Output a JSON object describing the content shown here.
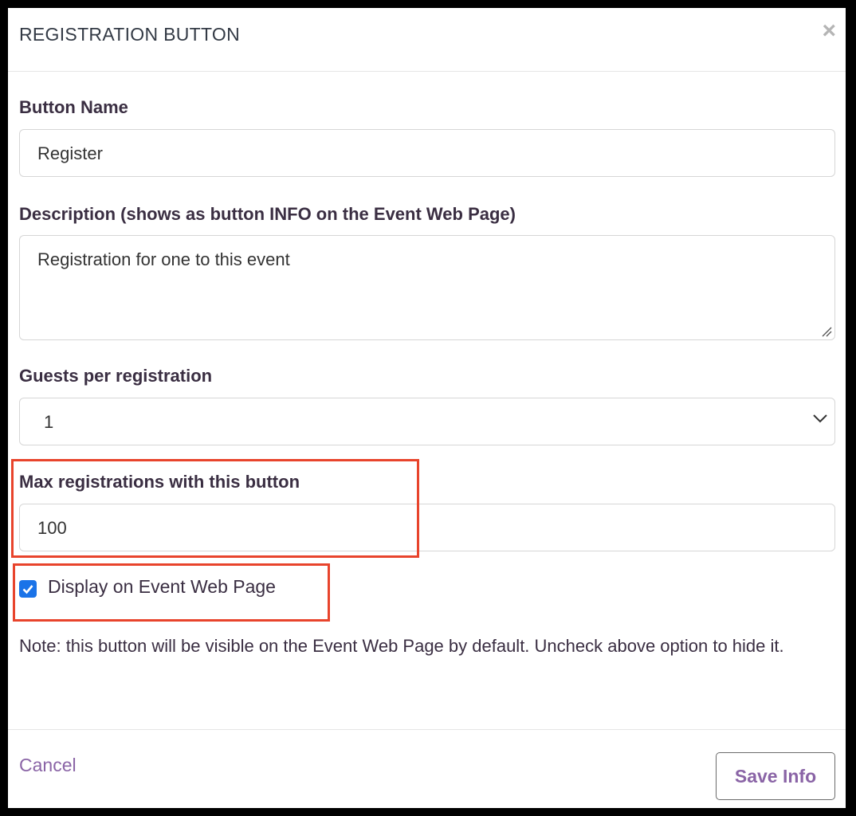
{
  "dialog": {
    "title": "REGISTRATION BUTTON",
    "close_symbol": "×",
    "close_icon": "close-icon"
  },
  "form": {
    "button_name": {
      "label": "Button Name",
      "value": "Register"
    },
    "description": {
      "label": "Description (shows as button INFO on the Event Web Page)",
      "value": "Registration for one to this event"
    },
    "guests": {
      "label": "Guests per registration",
      "selected": "1",
      "icon": "chevron-down-icon"
    },
    "max_registrations": {
      "label": "Max registrations with this button",
      "value": "100"
    },
    "display": {
      "label": "Display on Event Web Page",
      "checked": true
    },
    "note": "Note: this button will be visible on the Event Web Page by default. Uncheck above option to hide it."
  },
  "footer": {
    "cancel_label": "Cancel",
    "save_label": "Save Info"
  },
  "colors": {
    "accent": "#8a64a6",
    "checkbox": "#1a73e8",
    "highlight": "#e8442c"
  }
}
